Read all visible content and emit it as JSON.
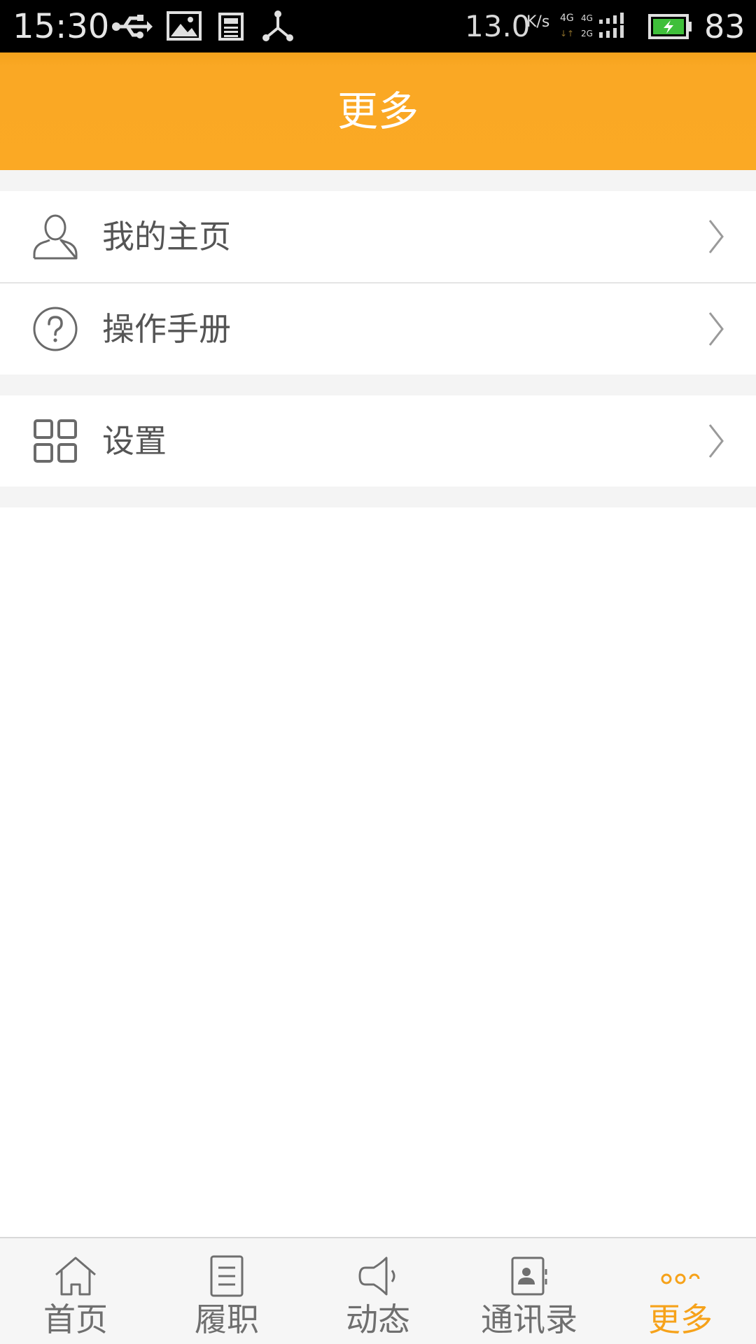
{
  "status_bar": {
    "time": "15:30",
    "speed": "13.0",
    "speed_unit": "K/s",
    "battery": "83",
    "icons": [
      "usb-icon",
      "image-icon",
      "news-icon",
      "share-icon",
      "signal-icon",
      "battery-icon"
    ]
  },
  "header": {
    "title": "更多"
  },
  "menu": {
    "items": [
      {
        "label": "我的主页",
        "icon": "user-icon"
      },
      {
        "label": "操作手册",
        "icon": "help-icon"
      },
      {
        "label": "设置",
        "icon": "grid-icon"
      }
    ]
  },
  "bottom_nav": {
    "items": [
      {
        "label": "首页",
        "icon": "home-icon",
        "active": false
      },
      {
        "label": "履职",
        "icon": "document-icon",
        "active": false
      },
      {
        "label": "动态",
        "icon": "megaphone-icon",
        "active": false
      },
      {
        "label": "通讯录",
        "icon": "contacts-icon",
        "active": false
      },
      {
        "label": "更多",
        "icon": "more-icon",
        "active": true
      }
    ]
  },
  "colors": {
    "accent": "#fba924",
    "active_tab": "#f6a21a",
    "text": "#555555",
    "inactive_tab": "#6f6f6f"
  }
}
